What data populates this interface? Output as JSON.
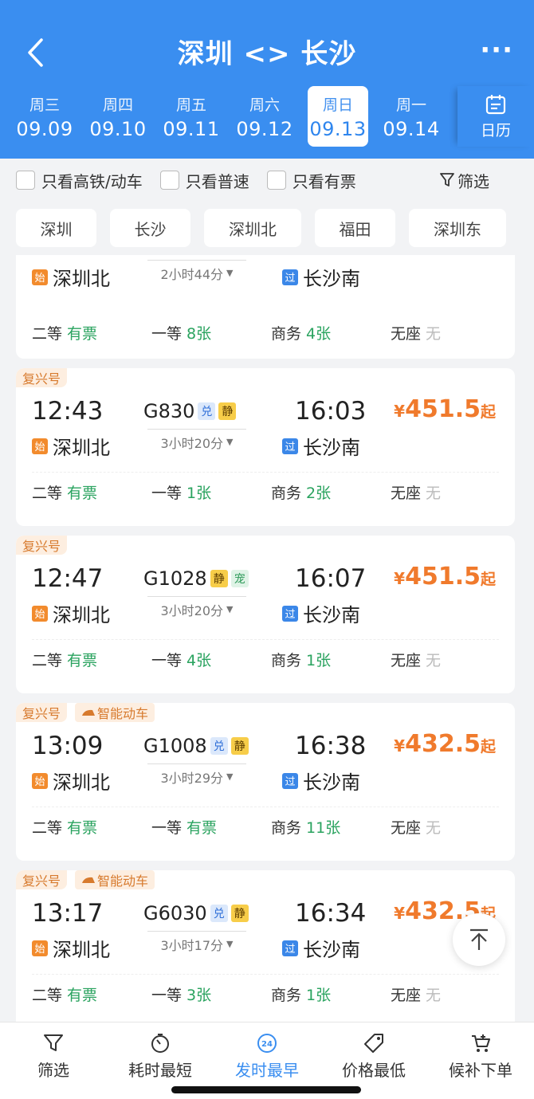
{
  "header": {
    "title": "深圳 <> 长沙",
    "more": "···"
  },
  "dates": [
    {
      "weekday": "周三",
      "date": "09.09"
    },
    {
      "weekday": "周四",
      "date": "09.10"
    },
    {
      "weekday": "周五",
      "date": "09.11"
    },
    {
      "weekday": "周六",
      "date": "09.12"
    },
    {
      "weekday": "周日",
      "date": "09.13",
      "active": true
    },
    {
      "weekday": "周一",
      "date": "09.14"
    }
  ],
  "calendar_label": "日历",
  "filters": {
    "high_speed": "只看高铁/动车",
    "normal": "只看普速",
    "available": "只看有票",
    "filter": "筛选"
  },
  "stations": [
    "深圳",
    "长沙",
    "深圳北",
    "福田",
    "深圳东"
  ],
  "trains": [
    {
      "partial": true,
      "from": "深圳北",
      "to": "长沙南",
      "duration": "2小时44分",
      "seats": [
        {
          "label": "二等",
          "value": "有票"
        },
        {
          "label": "一等",
          "value": "8张"
        },
        {
          "label": "商务",
          "value": "4张"
        },
        {
          "label": "无座",
          "value": "无"
        }
      ]
    },
    {
      "tags": [
        "复兴号"
      ],
      "dep": "12:43",
      "arr": "16:03",
      "number": "G830",
      "badges": [
        "兑",
        "静"
      ],
      "price_currency": "¥",
      "price": "451.5",
      "price_suffix": "起",
      "from": "深圳北",
      "to": "长沙南",
      "duration": "3小时20分",
      "start_icon": "始",
      "pass_icon": "过",
      "seats": [
        {
          "label": "二等",
          "value": "有票"
        },
        {
          "label": "一等",
          "value": "1张"
        },
        {
          "label": "商务",
          "value": "2张"
        },
        {
          "label": "无座",
          "value": "无"
        }
      ]
    },
    {
      "tags": [
        "复兴号"
      ],
      "dep": "12:47",
      "arr": "16:07",
      "number": "G1028",
      "badges": [
        "静",
        "宠"
      ],
      "price_currency": "¥",
      "price": "451.5",
      "price_suffix": "起",
      "from": "深圳北",
      "to": "长沙南",
      "duration": "3小时20分",
      "start_icon": "始",
      "pass_icon": "过",
      "seats": [
        {
          "label": "二等",
          "value": "有票"
        },
        {
          "label": "一等",
          "value": "4张"
        },
        {
          "label": "商务",
          "value": "1张"
        },
        {
          "label": "无座",
          "value": "无"
        }
      ]
    },
    {
      "tags": [
        "复兴号",
        "智能动车"
      ],
      "dep": "13:09",
      "arr": "16:38",
      "number": "G1008",
      "badges": [
        "兑",
        "静"
      ],
      "price_currency": "¥",
      "price": "432.5",
      "price_suffix": "起",
      "from": "深圳北",
      "to": "长沙南",
      "duration": "3小时29分",
      "start_icon": "始",
      "pass_icon": "过",
      "seats": [
        {
          "label": "二等",
          "value": "有票"
        },
        {
          "label": "一等",
          "value": "有票"
        },
        {
          "label": "商务",
          "value": "11张"
        },
        {
          "label": "无座",
          "value": "无"
        }
      ]
    },
    {
      "tags": [
        "复兴号",
        "智能动车"
      ],
      "dep": "13:17",
      "arr": "16:34",
      "number": "G6030",
      "badges": [
        "兑",
        "静"
      ],
      "price_currency": "¥",
      "price": "432.5",
      "price_suffix": "起",
      "from": "深圳北",
      "to": "长沙南",
      "duration": "3小时17分",
      "start_icon": "始",
      "pass_icon": "过",
      "seats": [
        {
          "label": "二等",
          "value": "有票"
        },
        {
          "label": "一等",
          "value": "3张"
        },
        {
          "label": "商务",
          "value": "1张"
        },
        {
          "label": "无座",
          "value": "无"
        }
      ]
    }
  ],
  "bottom_nav": [
    {
      "label": "筛选",
      "icon": "filter-icon"
    },
    {
      "label": "耗时最短",
      "icon": "clock-icon"
    },
    {
      "label": "发时最早",
      "icon": "24h-icon",
      "active": true
    },
    {
      "label": "价格最低",
      "icon": "price-tag-icon"
    },
    {
      "label": "候补下单",
      "icon": "cart-icon"
    }
  ],
  "colors": {
    "header_blue": "#3a8ef0",
    "price_orange": "#f07a2c",
    "available_green": "#2aa35f"
  }
}
